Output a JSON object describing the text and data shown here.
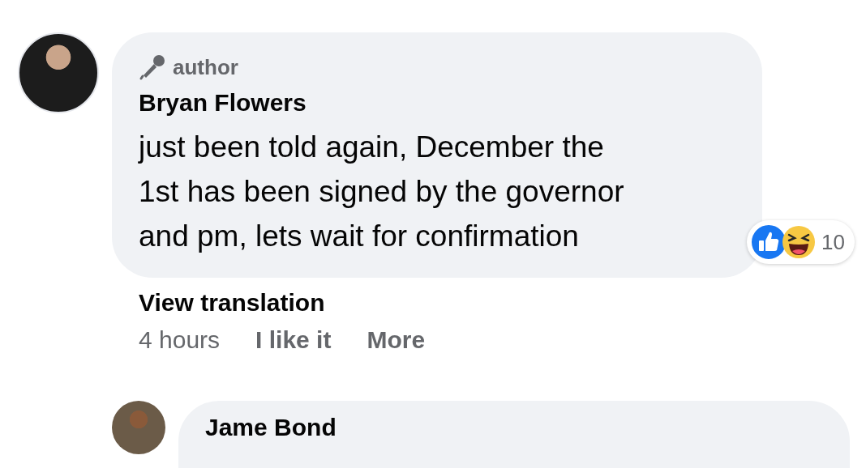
{
  "comment": {
    "badge": "author",
    "author": "Bryan Flowers",
    "text": "just been told again, December the 1st has been signed by the governor and pm, lets wait for confirmation",
    "reactions": {
      "count": "10"
    },
    "translation_link": "View translation",
    "time": "4 hours",
    "actions": [
      "I like it",
      "More"
    ]
  },
  "reply": {
    "author": "Jame Bond"
  }
}
